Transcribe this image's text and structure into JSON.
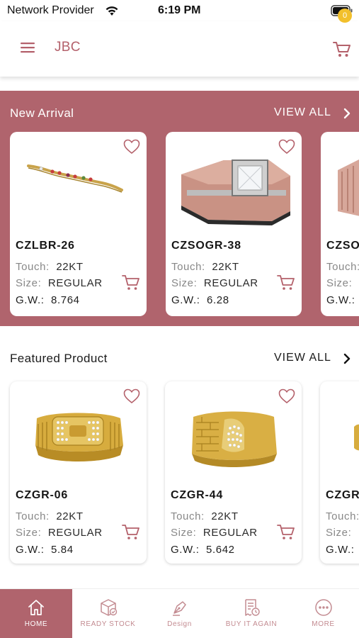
{
  "status_bar": {
    "carrier": "Network Provider",
    "time": "6:19 PM"
  },
  "header": {
    "title": "JBC",
    "cart_count": "0"
  },
  "colors": {
    "brand": "#b0646d",
    "title": "#b4616b",
    "badge": "#f2c02c"
  },
  "new_arrival": {
    "title": "New Arrival",
    "view_all": "VIEW ALL",
    "items": [
      {
        "code": "CZLBR-26",
        "touch_label": "Touch:",
        "touch": "22KT",
        "size_label": "Size:",
        "size": "REGULAR",
        "gw_label": "G.W.:",
        "gw": "8.764",
        "icon": "bracelet-image"
      },
      {
        "code": "CZSOGR-38",
        "touch_label": "Touch:",
        "touch": "22KT",
        "size_label": "Size:",
        "size": "REGULAR",
        "gw_label": "G.W.:",
        "gw": "6.28",
        "icon": "ring-image"
      },
      {
        "code": "CZSO",
        "touch_label": "Touch:",
        "size_label": "Size:",
        "gw_label": "G.W.:",
        "icon": "ring-image"
      }
    ]
  },
  "featured": {
    "title": "Featured Product",
    "view_all": "VIEW ALL",
    "items": [
      {
        "code": "CZGR-06",
        "touch_label": "Touch:",
        "touch": "22KT",
        "size_label": "Size:",
        "size": "REGULAR",
        "gw_label": "G.W.:",
        "gw": "5.84",
        "icon": "gold-ring-image"
      },
      {
        "code": "CZGR-44",
        "touch_label": "Touch:",
        "touch": "22KT",
        "size_label": "Size:",
        "size": "REGULAR",
        "gw_label": "G.W.:",
        "gw": "5.642",
        "icon": "gold-ring-image"
      },
      {
        "code": "CZGR",
        "touch_label": "Touch:",
        "size_label": "Size:",
        "gw_label": "G.W.:",
        "icon": "gold-ring-image"
      }
    ]
  },
  "bottom_nav": [
    {
      "label": "HOME",
      "icon": "home-icon",
      "active": true
    },
    {
      "label": "READY STOCK",
      "icon": "box-check-icon"
    },
    {
      "label": "Design",
      "icon": "pen-nib-icon"
    },
    {
      "label": "BUY IT AGAIN",
      "icon": "receipt-clock-icon"
    },
    {
      "label": "MORE",
      "icon": "more-dots-icon"
    }
  ]
}
